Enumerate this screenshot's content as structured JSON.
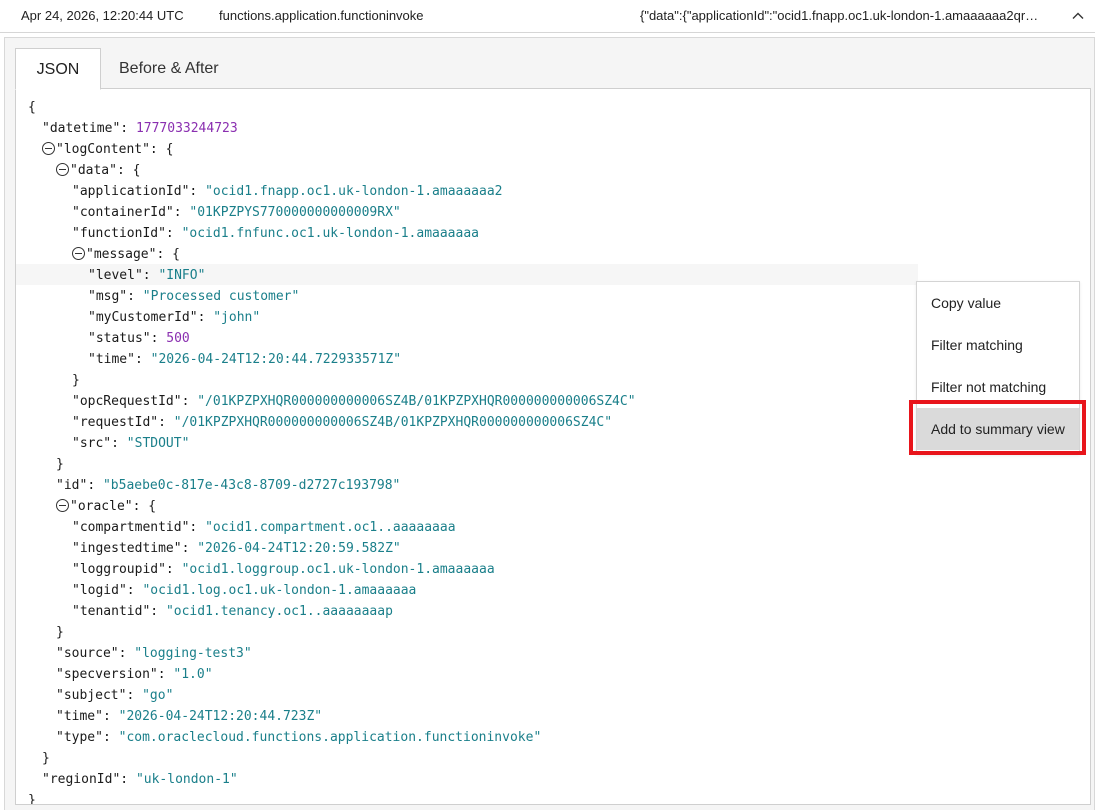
{
  "log_row": {
    "timestamp": "Apr 24, 2026, 12:20:44 UTC",
    "event_type": "functions.application.functioninvoke",
    "data_preview": "{\"data\":{\"applicationId\":\"ocid1.fnapp.oc1.uk-london-1.amaaaaaa2qr…"
  },
  "tabs": [
    {
      "label": "JSON"
    },
    {
      "label": "Before & After"
    }
  ],
  "json": {
    "l0": "{",
    "datetime_key": "\"datetime\"",
    "datetime_val": "1777033244723",
    "logContent_key": "\"logContent\"",
    "data_key": "\"data\"",
    "applicationId_key": "\"applicationId\"",
    "applicationId_val": "\"ocid1.fnapp.oc1.uk-london-1.amaaaaaa2",
    "containerId_key": "\"containerId\"",
    "containerId_val": "\"01KPZPYS770000000000009RX\"",
    "functionId_key": "\"functionId\"",
    "functionId_val": "\"ocid1.fnfunc.oc1.uk-london-1.amaaaaaa",
    "message_key": "\"message\"",
    "level_key": "\"level\"",
    "level_val": "\"INFO\"",
    "msg_key": "\"msg\"",
    "msg_val": "\"Processed customer\"",
    "myCustomerId_key": "\"myCustomerId\"",
    "myCustomerId_val": "\"john\"",
    "status_key": "\"status\"",
    "status_val": "500",
    "time_key": "\"time\"",
    "time_val": "\"2026-04-24T12:20:44.722933571Z\"",
    "opcRequestId_key": "\"opcRequestId\"",
    "opcRequestId_val": "\"/01KPZPXHQR000000000006SZ4B/01KPZPXHQR000000000006SZ4C\"",
    "requestId_key": "\"requestId\"",
    "requestId_val": "\"/01KPZPXHQR000000000006SZ4B/01KPZPXHQR000000000006SZ4C\"",
    "src_key": "\"src\"",
    "src_val": "\"STDOUT\"",
    "id_key": "\"id\"",
    "id_val": "\"b5aebe0c-817e-43c8-8709-d2727c193798\"",
    "oracle_key": "\"oracle\"",
    "compartmentid_key": "\"compartmentid\"",
    "compartmentid_val": "\"ocid1.compartment.oc1..aaaaaaaa",
    "ingestedtime_key": "\"ingestedtime\"",
    "ingestedtime_val": "\"2026-04-24T12:20:59.582Z\"",
    "loggroupid_key": "\"loggroupid\"",
    "loggroupid_val": "\"ocid1.loggroup.oc1.uk-london-1.amaaaaaa",
    "logid_key": "\"logid\"",
    "logid_val": "\"ocid1.log.oc1.uk-london-1.amaaaaaa",
    "tenantid_key": "\"tenantid\"",
    "tenantid_val": "\"ocid1.tenancy.oc1..aaaaaaaap",
    "source_key": "\"source\"",
    "source_val": "\"logging-test3\"",
    "specversion_key": "\"specversion\"",
    "specversion_val": "\"1.0\"",
    "subject_key": "\"subject\"",
    "subject_val": "\"go\"",
    "time2_key": "\"time\"",
    "time2_val": "\"2026-04-24T12:20:44.723Z\"",
    "type_key": "\"type\"",
    "type_val": "\"com.oraclecloud.functions.application.functioninvoke\"",
    "regionId_key": "\"regionId\"",
    "regionId_val": "\"uk-london-1\"",
    "open_brace": "{",
    "close_brace": "}",
    "colon": ": ",
    "colon_open": ": {"
  },
  "context_menu": {
    "items": [
      {
        "label": "Copy value"
      },
      {
        "label": "Filter matching"
      },
      {
        "label": "Filter not matching"
      },
      {
        "label": "Add to summary view"
      }
    ]
  },
  "colors": {
    "string": "#1a7f8a",
    "number": "#8a2fb0",
    "highlight": "#e8141b"
  }
}
